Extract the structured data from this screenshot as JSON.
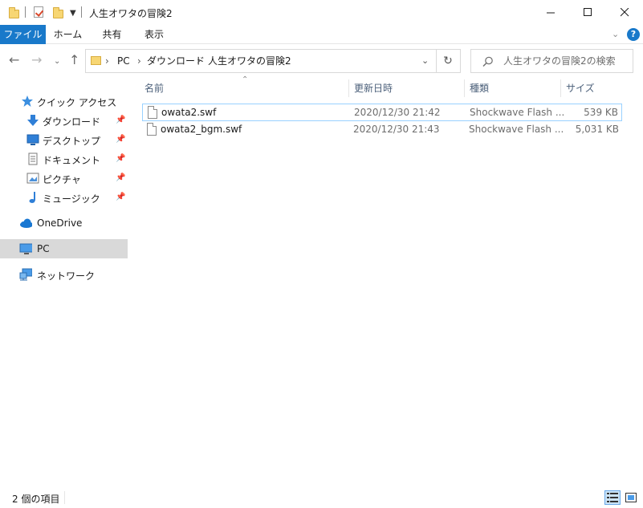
{
  "window": {
    "title": "人生オワタの冒険2"
  },
  "ribbon": {
    "tabs": [
      "ファイル",
      "ホーム",
      "共有",
      "表示"
    ],
    "help_label": "?"
  },
  "address": {
    "breadcrumbs": [
      "PC",
      "ダウンロード",
      "人生オワタの冒険2"
    ],
    "search_placeholder": "人生オワタの冒険2の検索"
  },
  "sidebar": {
    "quick_access_label": "クイック アクセス",
    "quick_items": [
      {
        "label": "ダウンロード",
        "icon": "download-icon"
      },
      {
        "label": "デスクトップ",
        "icon": "desktop-icon"
      },
      {
        "label": "ドキュメント",
        "icon": "document-icon"
      },
      {
        "label": "ピクチャ",
        "icon": "picture-icon"
      },
      {
        "label": "ミュージック",
        "icon": "music-icon"
      }
    ],
    "onedrive_label": "OneDrive",
    "pc_label": "PC",
    "network_label": "ネットワーク"
  },
  "file_list": {
    "columns": [
      "名前",
      "更新日時",
      "種類",
      "サイズ"
    ],
    "rows": [
      {
        "name": "owata2.swf",
        "modified": "2020/12/30 21:42",
        "type": "Shockwave Flash ...",
        "size": "539 KB"
      },
      {
        "name": "owata2_bgm.swf",
        "modified": "2020/12/30 21:43",
        "type": "Shockwave Flash ...",
        "size": "5,031 KB"
      }
    ]
  },
  "status": {
    "item_count": "2 個の項目"
  },
  "colors": {
    "accent": "#1979ca",
    "selection_border": "#99d1ff",
    "selected_nav": "#d9d9d9",
    "column_header_text": "#4c607a"
  }
}
